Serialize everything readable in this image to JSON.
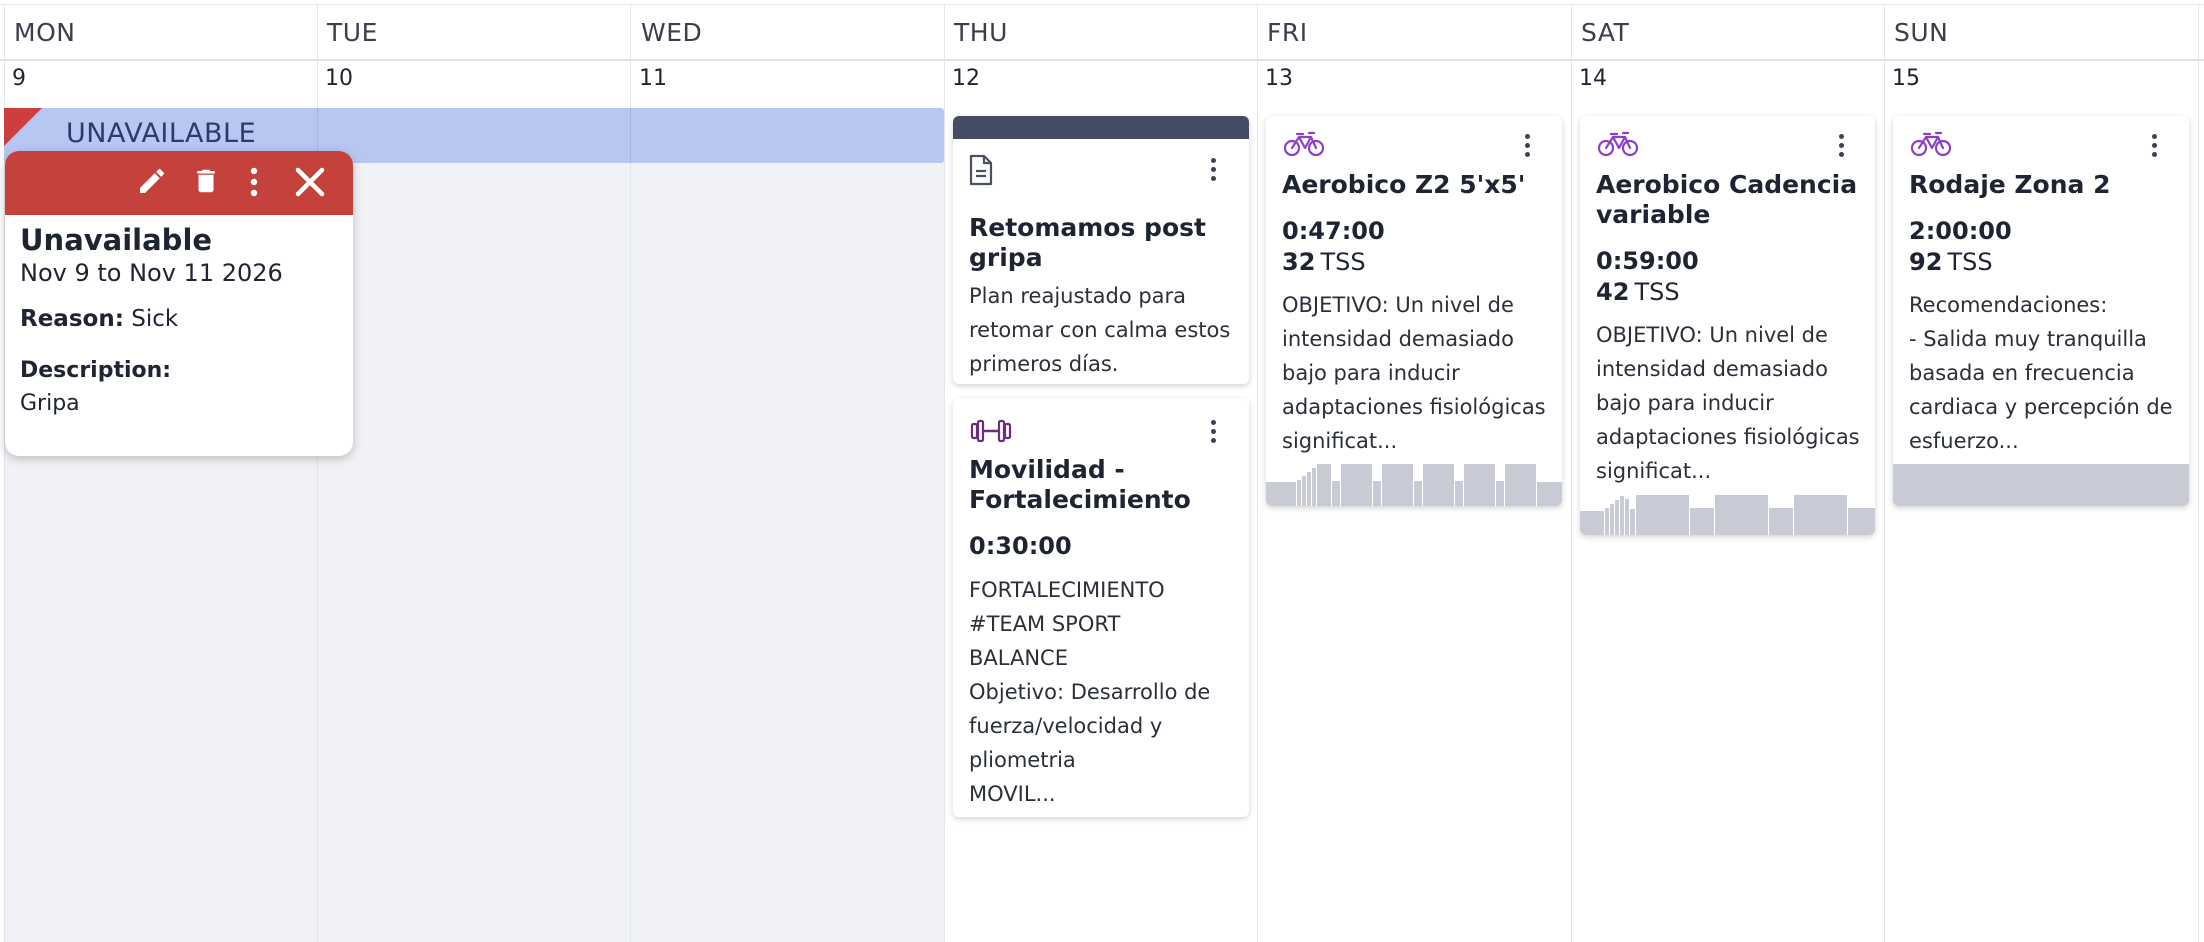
{
  "days": [
    {
      "name": "MON",
      "num": "9"
    },
    {
      "name": "TUE",
      "num": "10"
    },
    {
      "name": "WED",
      "num": "11"
    },
    {
      "name": "THU",
      "num": "12"
    },
    {
      "name": "FRI",
      "num": "13"
    },
    {
      "name": "SAT",
      "num": "14"
    },
    {
      "name": "SUN",
      "num": "15"
    }
  ],
  "unavailable": {
    "label": "UNAVAILABLE",
    "popup": {
      "title": "Unavailable",
      "dates": "Nov 9 to Nov 11 2026",
      "reason_label": "Reason:",
      "reason_value": "Sick",
      "description_label": "Description:",
      "description_value": "Gripa"
    }
  },
  "workouts": {
    "thu_note": {
      "icon": "document-icon",
      "title": "Retomamos post gripa",
      "description": "Plan reajustado para retomar con calma estos primeros días."
    },
    "thu_strength": {
      "icon": "dumbbell-icon",
      "title": "Movilidad - Fortalecimiento",
      "duration": "0:30:00",
      "description": "FORTALECIMIENTO\n#TEAM SPORT\nBALANCE\nObjetivo: Desarrollo de fuerza/velocidad y pliometria\nMOVIL..."
    },
    "fri": {
      "icon": "bike-icon",
      "title": "Aerobico Z2 5'x5'",
      "duration": "0:47:00",
      "tss_value": "32",
      "tss_label": "TSS",
      "description": "OBJETIVO: Un nivel de intensidad demasiado bajo para inducir adaptaciones fisiológicas significat..."
    },
    "sat": {
      "icon": "bike-icon",
      "title": "Aerobico Cadencia variable",
      "duration": "0:59:00",
      "tss_value": "42",
      "tss_label": "TSS",
      "description": "OBJETIVO: Un nivel de intensidad demasiado bajo para inducir adaptaciones fisiológicas significat..."
    },
    "sun": {
      "icon": "bike-icon",
      "title": "Rodaje Zona 2",
      "duration": "2:00:00",
      "tss_value": "92",
      "tss_label": "TSS",
      "description": "Recomendaciones:\n- Salida muy tranquilla basada en frecuencia cardiaca y percepción de esfuerzo..."
    }
  },
  "colors": {
    "unavailable_bar": "#b8c6f2",
    "popup_header": "#c5413c",
    "bike_icon": "#8e3fc9",
    "strength_icon": "#6b2d7f",
    "note_header": "#454d66"
  }
}
